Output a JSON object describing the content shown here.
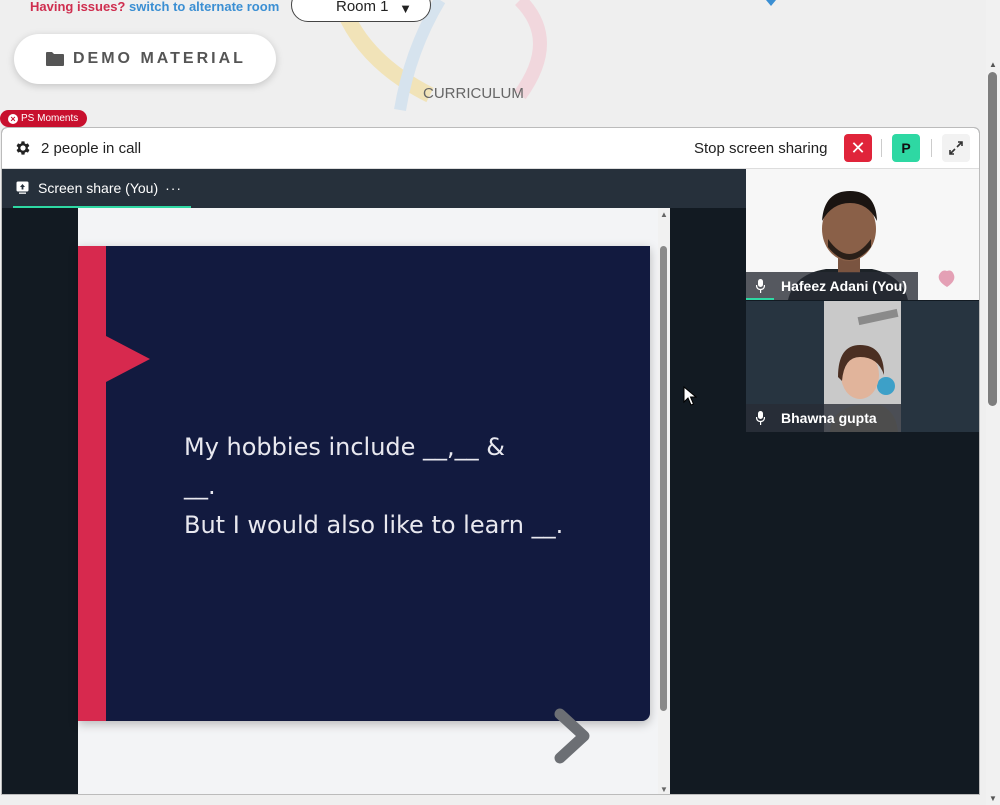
{
  "top": {
    "issues_text": "Having issues?",
    "alternate_link": "switch to alternate room",
    "room_value": "Room 1",
    "demo_label": "DEMO MATERIAL",
    "curriculum_label": "CURRICULUM",
    "ps_badge": "PS Moments"
  },
  "call": {
    "people_count": "2 people in call",
    "stop_sharing": "Stop screen sharing",
    "stop_icon": "close-icon",
    "participant_initial": "P",
    "participant_color": "#2ed8a3",
    "expand_icon": "expand-icon",
    "tab_label": "Screen share (You)",
    "tab_more": "···"
  },
  "slide": {
    "line1": "My hobbies include __,__ &",
    "line2": "__.",
    "line3": "But I would also like to learn __.",
    "accent_color": "#d7294e",
    "background_color": "#121a3f"
  },
  "participants": [
    {
      "name": "Hafeez Adani (You)",
      "mic": "microphone-icon"
    },
    {
      "name": "Bhawna gupta",
      "mic": "microphone-icon"
    }
  ],
  "colors": {
    "brand_red": "#cf2e4f",
    "link_blue": "#3b8fd3",
    "stop_red": "#e0243a"
  }
}
